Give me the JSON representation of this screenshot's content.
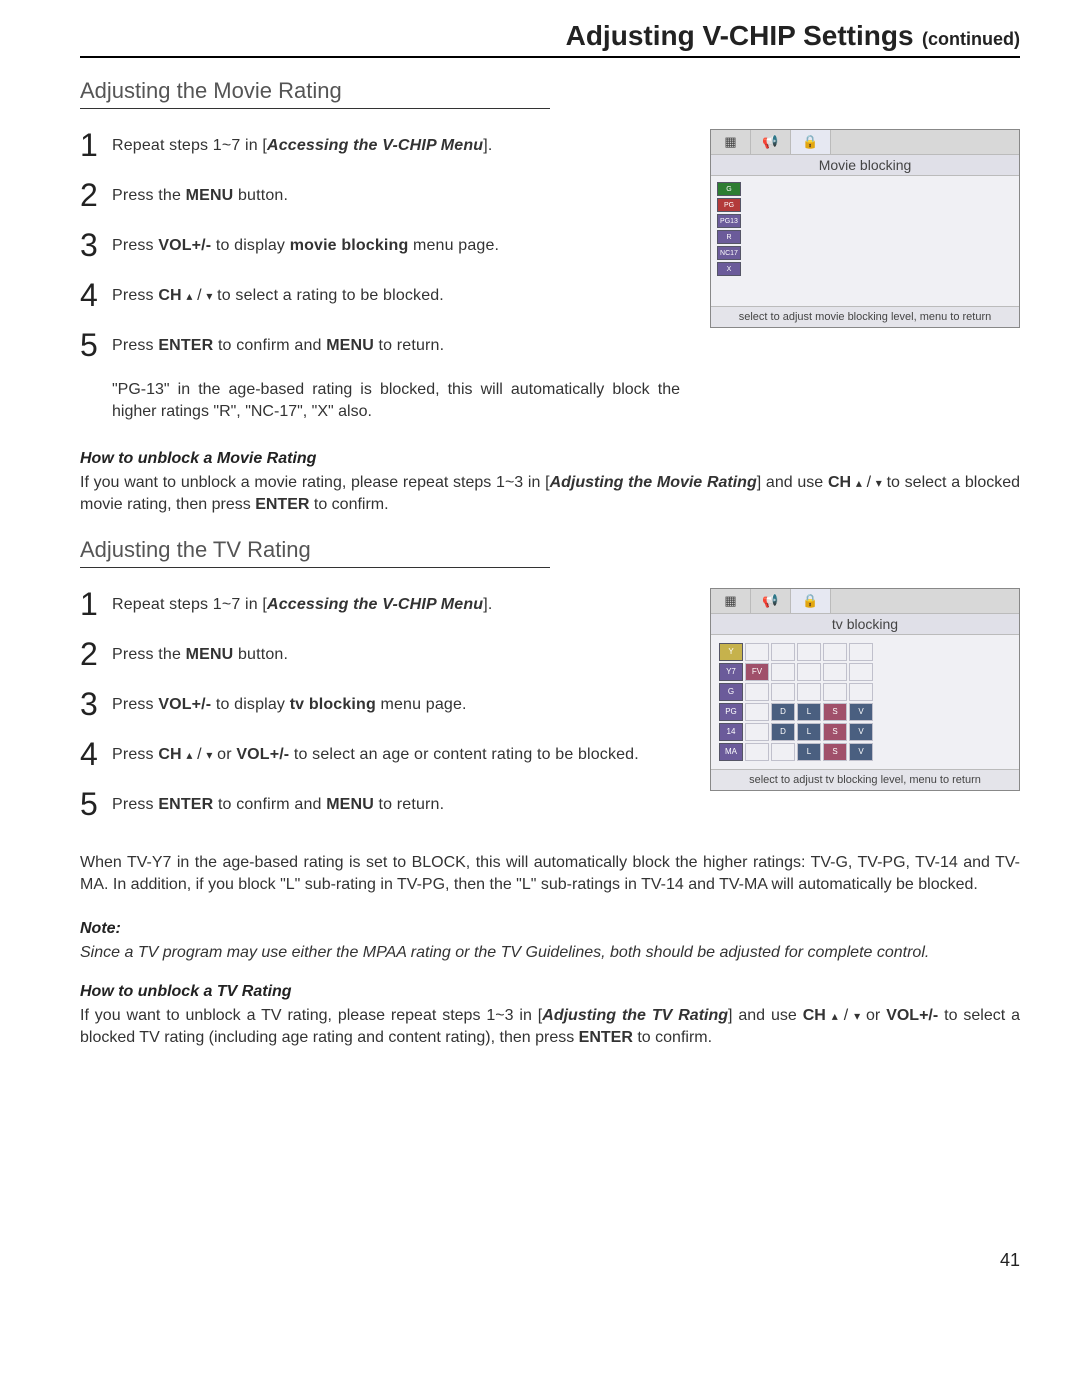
{
  "header": {
    "title": "Adjusting V-CHIP Settings",
    "continued": "(continued)"
  },
  "section_movie": {
    "heading": "Adjusting the Movie Rating",
    "steps": [
      {
        "num": "1",
        "pre": "Repeat steps 1~7 in [",
        "bold": "Accessing the V-CHIP Menu",
        "post": "]."
      },
      {
        "num": "2",
        "pre": "Press  the ",
        "bold": "MENU",
        "post": " button."
      },
      {
        "num": "3",
        "pre": "Press  ",
        "bold": "VOL+/-",
        "post": " to display ",
        "bold2": "movie blocking",
        "post2": " menu page."
      },
      {
        "num": "4",
        "pre": "Press  ",
        "bold": "CH",
        "arrows": true,
        "post": " to select a rating to be blocked."
      },
      {
        "num": "5",
        "pre": "Press ",
        "bold": "ENTER",
        "mid": " to confirm and ",
        "bold2": "MENU",
        "post": " to return."
      }
    ],
    "auto_block_note": "\"PG-13\" in the age-based rating is blocked, this will automatically block the higher ratings \"R\", \"NC-17\", \"X\" also.",
    "unblock_heading": "How to unblock a Movie Rating",
    "unblock_text_pre": "If you want to unblock a movie rating, please repeat steps 1~3 in [",
    "unblock_text_bold1": "Adjusting the Movie Rating",
    "unblock_text_mid1": "] and use ",
    "unblock_text_bold2": "CH",
    "unblock_text_mid2": " to select a blocked movie rating, then press ",
    "unblock_text_bold3": "ENTER",
    "unblock_text_post": " to confirm.",
    "osd": {
      "title": "Movie blocking",
      "ratings": [
        "G",
        "PG",
        "PG13",
        "R",
        "NC17",
        "X"
      ],
      "footer": "select to adjust movie blocking level, menu to return"
    }
  },
  "section_tv": {
    "heading": "Adjusting the TV Rating",
    "steps": [
      {
        "num": "1",
        "pre": "Repeat steps 1~7 in [",
        "bold": "Accessing the V-CHIP Menu",
        "post": "]."
      },
      {
        "num": "2",
        "pre": "Press  the ",
        "bold": "MENU",
        "post": " button."
      },
      {
        "num": "3",
        "pre": "Press  ",
        "bold": "VOL+/-",
        "post": " to display ",
        "bold2": "tv blocking",
        "post2": " menu page."
      },
      {
        "num": "4",
        "pre": "Press   ",
        "bold": "CH",
        "arrows": true,
        "mid": " or ",
        "bold2": "VOL+/-",
        "post": " to select an age or content rating to be blocked."
      },
      {
        "num": "5",
        "pre": "Press ",
        "bold": "ENTER",
        "mid": " to confirm and ",
        "bold2": "MENU",
        "post": " to return."
      }
    ],
    "auto_block_note": "When TV-Y7 in the age-based rating is set to BLOCK, this will automatically block the higher ratings: TV-G, TV-PG, TV-14 and TV-MA. In addition, if you block \"L\" sub-rating in TV-PG, then the \"L\" sub-ratings in TV-14 and TV-MA will automatically be blocked.",
    "osd": {
      "title": "tv blocking",
      "rows": [
        "Y",
        "Y7",
        "G",
        "PG",
        "14",
        "MA"
      ],
      "cols": [
        "FV",
        "D",
        "L",
        "S",
        "V"
      ],
      "footer": "select to adjust tv blocking level, menu to return"
    }
  },
  "note": {
    "heading": "Note:",
    "text": "Since a TV program may use either the MPAA rating or the TV Guidelines, both should be adjusted for complete control."
  },
  "unblock_tv": {
    "heading": "How to unblock a TV Rating",
    "pre": "If you want to unblock a TV rating, please repeat steps 1~3 in [",
    "bold1": "Adjusting the TV Rating",
    "mid1": "] and use ",
    "bold2": "CH",
    "mid2": " or ",
    "bold3": "VOL+/-",
    "mid3": " to select a blocked TV rating (including age rating and content rating), then press ",
    "bold4": "ENTER",
    "post": " to confirm."
  },
  "page_number": "41"
}
